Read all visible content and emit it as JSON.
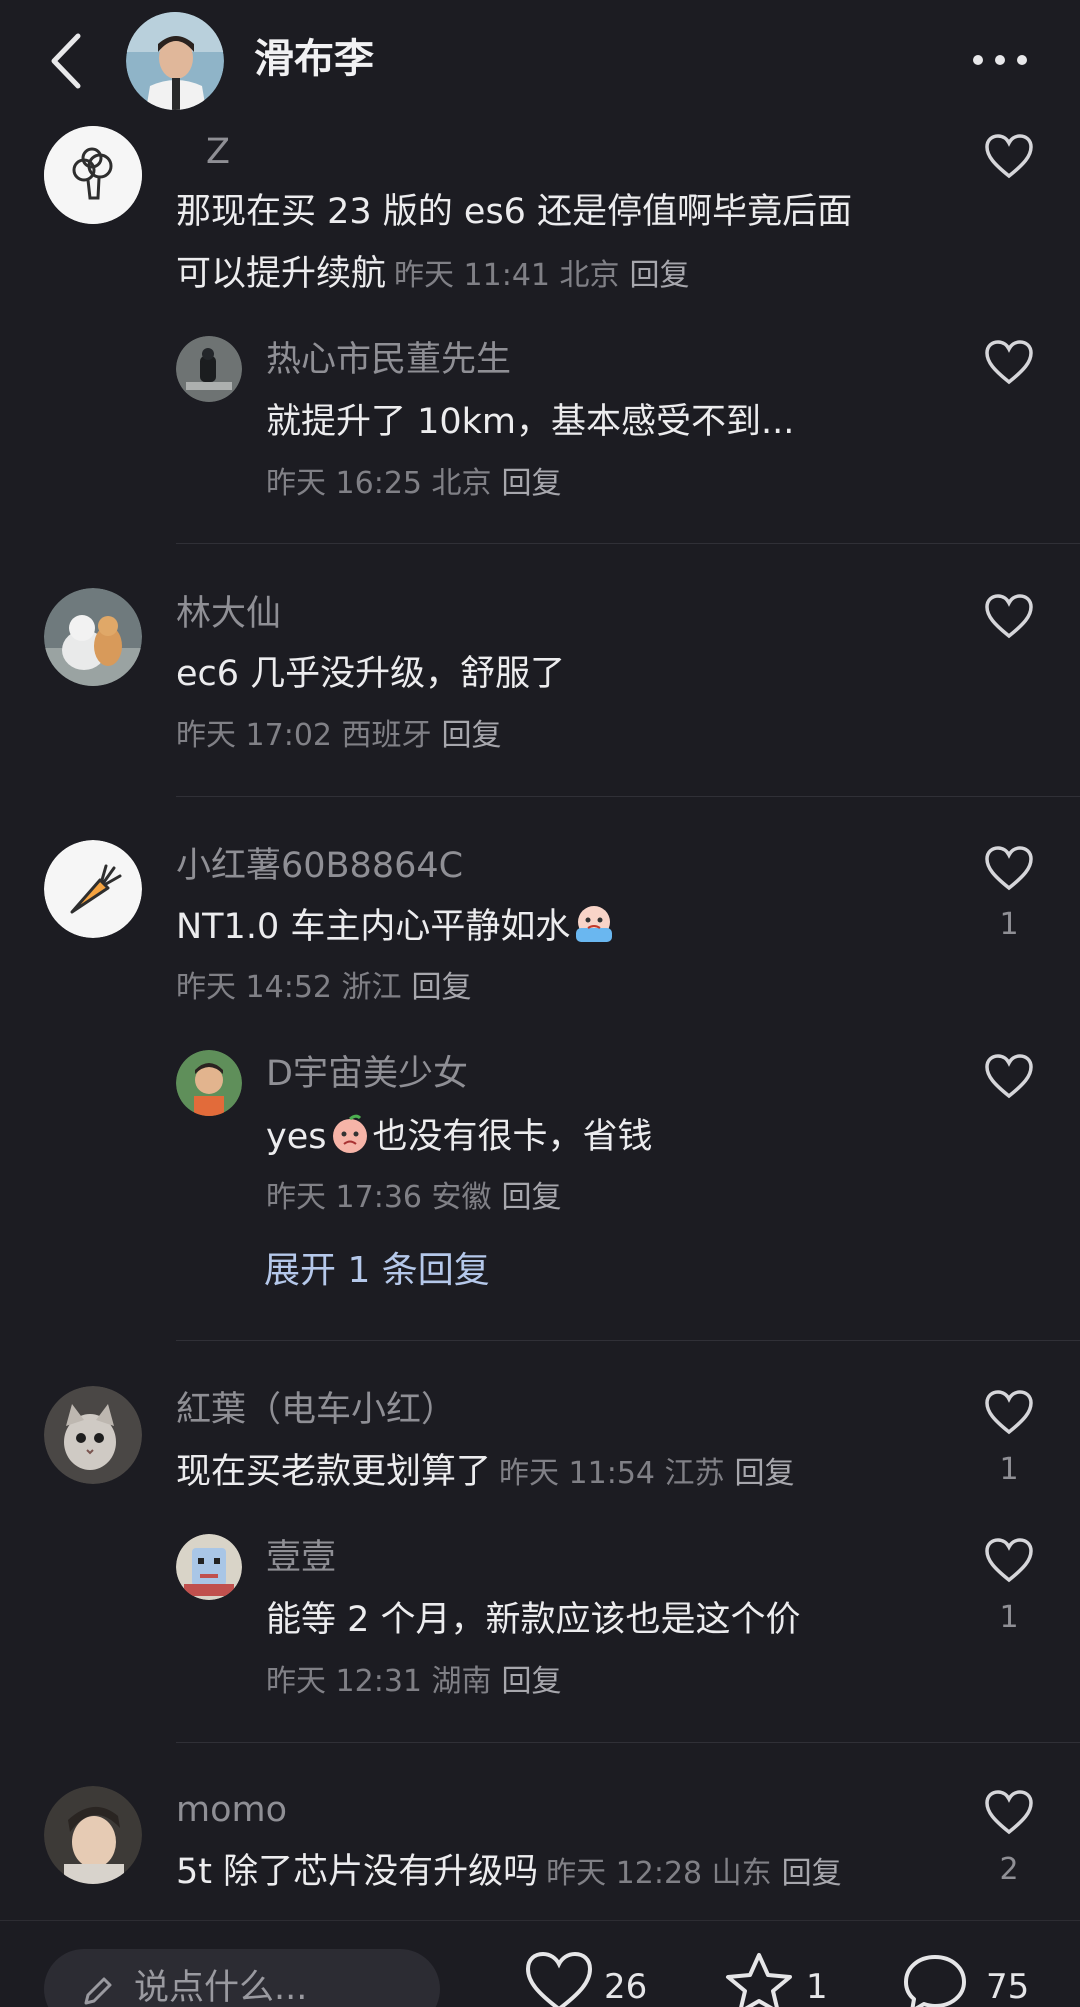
{
  "header": {
    "title": "滑布李"
  },
  "comments": [
    {
      "name": "Z",
      "text_line1": "那现在买 23 版的 es6 还是停值啊毕竟后面",
      "text_line2": "可以提升续航",
      "time": "昨天 11:41 北京",
      "reply": "回复"
    },
    {
      "name": "热心市民董先生",
      "text": "就提升了 10km，基本感受不到...",
      "time": "昨天 16:25 北京",
      "reply": "回复"
    },
    {
      "name": "林大仙",
      "text": "ec6 几乎没升级，舒服了",
      "time": "昨天 17:02 西班牙",
      "reply": "回复"
    },
    {
      "name": "小红薯60B8864C",
      "text": "NT1.0 车主内心平静如水",
      "time": "昨天 14:52 浙江",
      "reply": "回复",
      "likes": "1"
    },
    {
      "name": "D宇宙美少女",
      "text_pre": "yes",
      "text_post": "也没有很卡，省钱",
      "time": "昨天 17:36 安徽",
      "reply": "回复"
    },
    {
      "name": "紅葉（电车小红）",
      "text": "现在买老款更划算了",
      "time": "昨天 11:54 江苏",
      "reply": "回复",
      "likes": "1"
    },
    {
      "name": "壹壹",
      "text": "能等 2 个月，新款应该也是这个价",
      "time": "昨天 12:31 湖南",
      "reply": "回复",
      "likes": "1"
    },
    {
      "name": "momo",
      "text": "5t 除了芯片没有升级吗",
      "time": "昨天 12:28 山东",
      "reply": "回复",
      "likes": "2"
    }
  ],
  "expand_label": "展开 1 条回复",
  "bottom_bar": {
    "input_placeholder": "说点什么...",
    "likes": "26",
    "favorites": "1",
    "comments": "75"
  },
  "icons": {
    "back": "chevron-left-icon",
    "more": "more-dots-icon",
    "like": "heart-icon",
    "favorite": "star-icon",
    "comment": "comment-bubble-icon",
    "edit": "pencil-icon"
  },
  "colors": {
    "background": "#1c1c22",
    "expand_link": "#b5c8ea"
  }
}
